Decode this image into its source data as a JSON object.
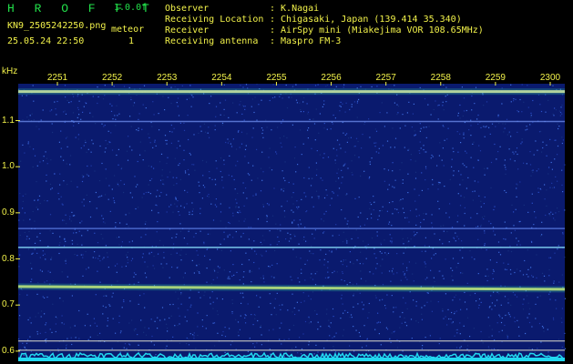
{
  "header": {
    "title": "H R O F F T",
    "version": "1.0.0f",
    "filename": "KN9_2505242250.png",
    "meteor_label": "meteor",
    "timestamp": "25.05.24 22:50",
    "meteor_count": "1",
    "fields": [
      {
        "label": "Observer",
        "value": ": K.Nagai"
      },
      {
        "label": "Receiving Location",
        "value": ": Chigasaki, Japan (139.414 35.340)"
      },
      {
        "label": "Receiver",
        "value": ": AirSpy mini (Miakejima VOR 108.65MHz)"
      },
      {
        "label": "Receiving antenna",
        "value": ": Maspro FM-3"
      }
    ]
  },
  "chart_data": {
    "type": "heatmap",
    "title": "",
    "xlabel": "",
    "ylabel": "kHz",
    "x_ticks": [
      "2251",
      "2252",
      "2253",
      "2254",
      "2255",
      "2256",
      "2257",
      "2258",
      "2259",
      "2300"
    ],
    "y_ticks": [
      1.1,
      1.0,
      0.9,
      0.8,
      0.7,
      0.6
    ],
    "ylim": [
      0.58,
      1.18
    ],
    "background_color": "#0a1a6e",
    "traces": [
      {
        "freq_khz": 1.163,
        "intensity": "strong",
        "color": "#e8e0a0"
      },
      {
        "freq_khz": 1.098,
        "intensity": "weak",
        "color": "#6f8ff0"
      },
      {
        "freq_khz": 0.866,
        "intensity": "weak",
        "color": "#5d7fe8"
      },
      {
        "freq_khz": 0.825,
        "intensity": "medium",
        "color": "#7fd0f0"
      },
      {
        "freq_khz": 0.74,
        "intensity": "strong",
        "color": "#d8e070"
      },
      {
        "freq_khz": 0.622,
        "intensity": "reference",
        "color": "#e8e8d0"
      },
      {
        "freq_khz": 0.602,
        "intensity": "reference",
        "color": "#e8e8d0"
      }
    ],
    "noise_floor_color": "#22d8f0"
  }
}
